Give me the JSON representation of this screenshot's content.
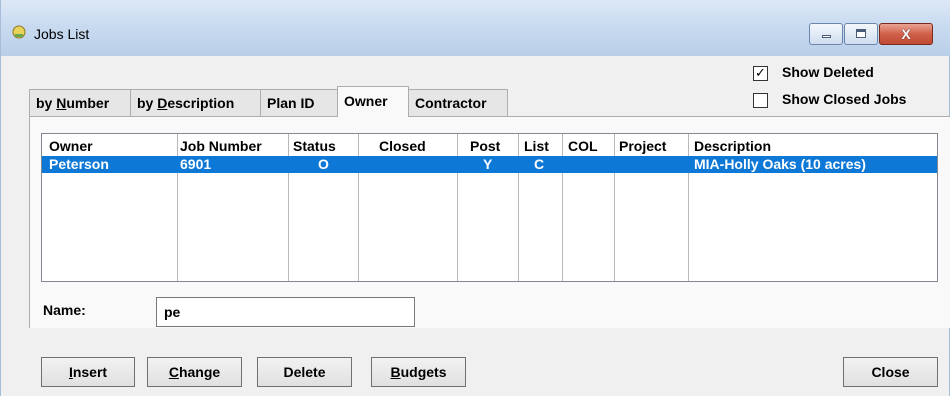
{
  "window": {
    "title": "Jobs List",
    "close_glyph": "X",
    "app_icon": "jobs-app-icon"
  },
  "tabs": [
    {
      "prefix": "by ",
      "accel": "N",
      "rest": "umber"
    },
    {
      "prefix": "by ",
      "accel": "D",
      "rest": "escription"
    },
    {
      "prefix": "",
      "accel": "",
      "rest": "Plan ID"
    },
    {
      "prefix": "",
      "accel": "",
      "rest": "Owner"
    },
    {
      "prefix": "",
      "accel": "",
      "rest": "Contractor"
    }
  ],
  "active_tab": "Owner",
  "options": {
    "show_deleted": {
      "label": "Show Deleted",
      "checked": true,
      "mark": "✓"
    },
    "show_closed": {
      "label": "Show Closed Jobs",
      "checked": false
    }
  },
  "table": {
    "columns": [
      "Owner",
      "Job Number",
      "Status",
      "Closed",
      "Post",
      "List",
      "COL",
      "Project",
      "Description"
    ],
    "rows": [
      {
        "owner": "Peterson",
        "job_number": "6901",
        "status": "O",
        "closed": "",
        "post": "Y",
        "list": "C",
        "col": "",
        "project": "",
        "description": "MIA-Holly Oaks (10 acres)"
      }
    ]
  },
  "name_field": {
    "label": "Name:",
    "value": "pe"
  },
  "buttons": {
    "insert": {
      "accel": "I",
      "rest": "nsert"
    },
    "change": {
      "accel": "C",
      "rest": "hange"
    },
    "delete": {
      "accel": "",
      "rest": "Delete"
    },
    "budgets": {
      "accel": "B",
      "rest": "udgets"
    },
    "close": {
      "accel": "",
      "rest": "Close"
    }
  },
  "colors": {
    "selection": "#0e78d6",
    "titlebar": "#c9dbf0",
    "close_button": "#c8543d"
  }
}
